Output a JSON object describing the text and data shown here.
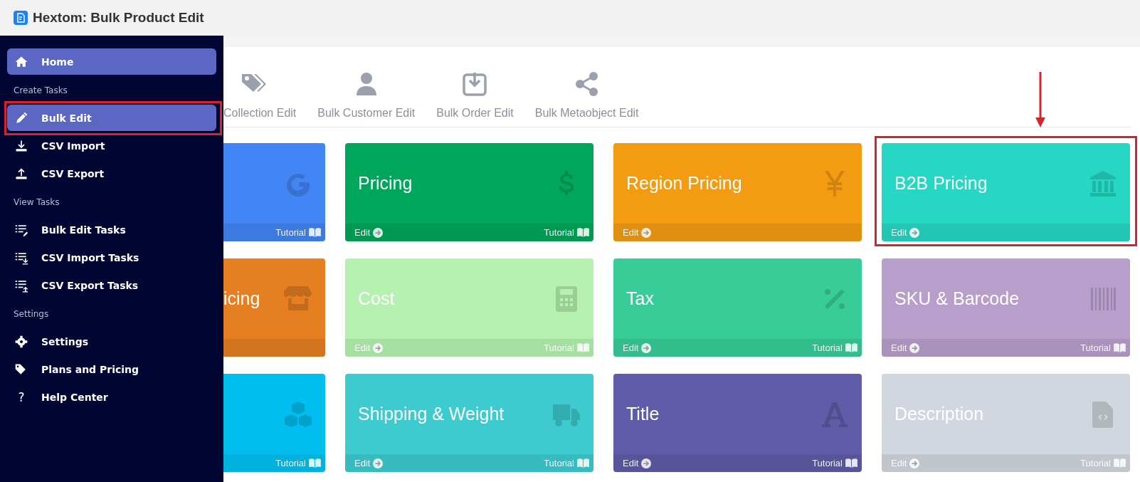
{
  "app": {
    "title": "Hextom: Bulk Product Edit"
  },
  "sidebar": {
    "items": [
      {
        "kind": "link",
        "label": "Home",
        "selected": true,
        "highlighted": false
      },
      {
        "kind": "heading",
        "label": "Create Tasks"
      },
      {
        "kind": "link",
        "label": "Bulk Edit",
        "selected": true,
        "highlighted": true
      },
      {
        "kind": "link",
        "label": "CSV Import",
        "selected": false,
        "highlighted": false
      },
      {
        "kind": "link",
        "label": "CSV Export",
        "selected": false,
        "highlighted": false
      },
      {
        "kind": "heading",
        "label": "View Tasks"
      },
      {
        "kind": "link",
        "label": "Bulk Edit Tasks",
        "selected": false,
        "highlighted": false
      },
      {
        "kind": "link",
        "label": "CSV Import Tasks",
        "selected": false,
        "highlighted": false
      },
      {
        "kind": "link",
        "label": "CSV Export Tasks",
        "selected": false,
        "highlighted": false
      },
      {
        "kind": "heading",
        "label": "Settings"
      },
      {
        "kind": "link",
        "label": "Settings",
        "selected": false,
        "highlighted": false
      },
      {
        "kind": "link",
        "label": "Plans and Pricing",
        "selected": false,
        "highlighted": false
      },
      {
        "kind": "link",
        "label": "Help Center",
        "symbol": "?",
        "selected": false,
        "highlighted": false
      }
    ]
  },
  "tabs": [
    {
      "label": "Collection Edit"
    },
    {
      "label": "Bulk Customer Edit"
    },
    {
      "label": "Bulk Order Edit"
    },
    {
      "label": "Bulk Metaobject Edit"
    }
  ],
  "cards": [
    {
      "color": "#4285f4",
      "tutorial": "Tutorial",
      "highlighted": false
    },
    {
      "color": "#00a65a",
      "title": "Pricing",
      "edit": "Edit",
      "tutorial": "Tutorial",
      "highlighted": false
    },
    {
      "color": "#f39c12",
      "title": "Region Pricing",
      "edit": "Edit",
      "highlighted": false
    },
    {
      "color": "#26d7c3",
      "title": "B2B Pricing",
      "edit": "Edit",
      "highlighted": true
    },
    {
      "color": "#e67e22",
      "title": "icing",
      "highlighted": false
    },
    {
      "color": "#b5f2b0",
      "title": "Cost",
      "edit": "Edit",
      "tutorial": "Tutorial",
      "highlighted": false
    },
    {
      "color": "#38cd98",
      "title": "Tax",
      "edit": "Edit",
      "tutorial": "Tutorial",
      "highlighted": false
    },
    {
      "color": "#b89fcb",
      "title": "SKU & Barcode",
      "edit": "Edit",
      "tutorial": "Tutorial",
      "highlighted": false
    },
    {
      "color": "#00bff0",
      "tutorial": "Tutorial",
      "highlighted": false
    },
    {
      "color": "#3dcbcf",
      "title": "Shipping & Weight",
      "edit": "Edit",
      "tutorial": "Tutorial",
      "highlighted": false
    },
    {
      "color": "#605ca8",
      "title": "Title",
      "edit": "Edit",
      "tutorial": "Tutorial",
      "highlighted": false
    },
    {
      "color": "#d2d6de",
      "title": "Description",
      "edit": "Edit",
      "tutorial": "Tutorial",
      "highlighted": false
    }
  ]
}
